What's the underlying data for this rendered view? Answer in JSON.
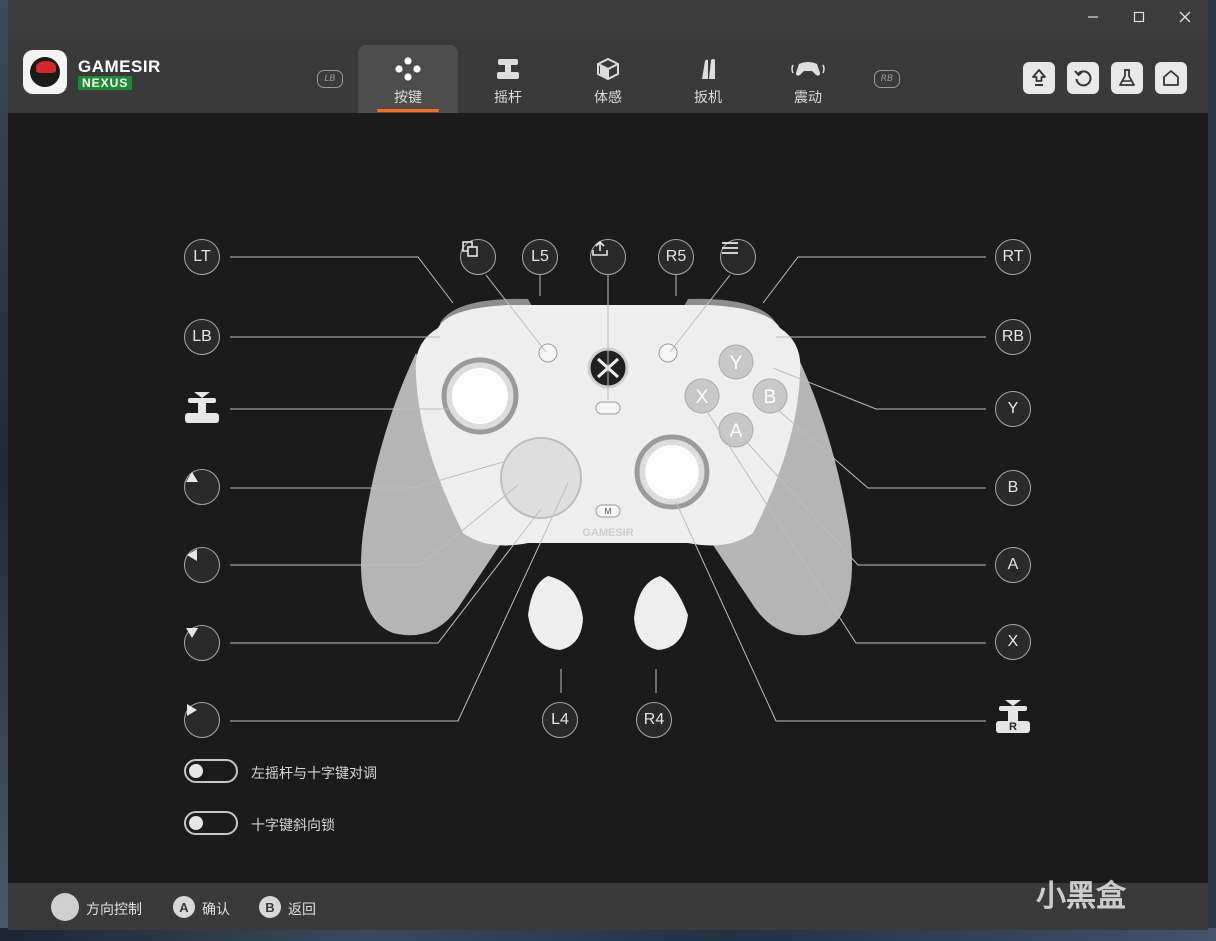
{
  "brand": {
    "name": "GAMESIR",
    "sub": "NEXUS"
  },
  "tabs": [
    {
      "label": "按键",
      "icon": "buttons-icon",
      "active": true
    },
    {
      "label": "摇杆",
      "icon": "joystick-icon",
      "active": false
    },
    {
      "label": "体感",
      "icon": "motion-icon",
      "active": false
    },
    {
      "label": "扳机",
      "icon": "trigger-icon",
      "active": false
    },
    {
      "label": "震动",
      "icon": "vibration-icon",
      "active": false
    }
  ],
  "bumpers": {
    "left": "LB",
    "right": "RB"
  },
  "header_buttons": [
    "upload-firmware-icon",
    "reset-icon",
    "lab-flask-icon",
    "home-icon"
  ],
  "mapping_buttons": {
    "lt": "LT",
    "lb": "LB",
    "l5": "L5",
    "r5": "R5",
    "rt": "RT",
    "rb": "RB",
    "y": "Y",
    "b": "B",
    "a": "A",
    "x": "X",
    "l4": "L4",
    "r4": "R4"
  },
  "stick_markers": {
    "right": "R"
  },
  "controller_labels": {
    "y": "Y",
    "b": "B",
    "x": "X",
    "a": "A",
    "m": "M",
    "brand": "GAMESIR"
  },
  "toggles": [
    {
      "label": "左摇杆与十字键对调",
      "on": false
    },
    {
      "label": "十字键斜向锁",
      "on": false
    }
  ],
  "footer": {
    "nav_label": "方向控制",
    "confirm_key": "A",
    "confirm_label": "确认",
    "back_key": "B",
    "back_label": "返回"
  },
  "watermark": "小黑盒",
  "colors": {
    "accent": "#ff6a1a",
    "brand_green": "#1f8a36",
    "logo_red": "#d8262a"
  }
}
